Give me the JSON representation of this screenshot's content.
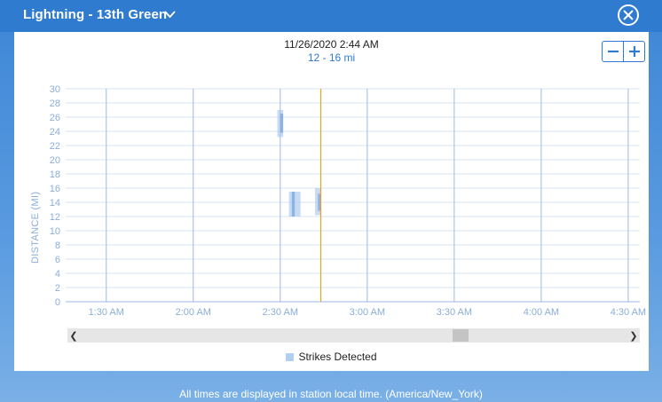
{
  "window": {
    "title": "Lightning - 13th Green"
  },
  "header": {
    "timestamp": "11/26/2020 2:44 AM",
    "range": "12 - 16 mi"
  },
  "colors": {
    "accent": "#2f7bd0",
    "strike_fill": "#a9c8ef",
    "strike_core": "#7aa6de",
    "current_time_line": "#f0a020",
    "grid": "#dbe6f2",
    "time_grid": "#9bbbe3"
  },
  "chart_data": {
    "type": "scatter",
    "ylabel": "DISTANCE (MI)",
    "ylim": [
      0,
      30
    ],
    "yticks": [
      0,
      2,
      4,
      6,
      8,
      10,
      12,
      14,
      16,
      18,
      20,
      22,
      24,
      26,
      28,
      30
    ],
    "x_tick_labels": [
      "1:30 AM",
      "2:00 AM",
      "2:30 AM",
      "3:00 AM",
      "3:30 AM",
      "4:00 AM",
      "4:30 AM"
    ],
    "x_tick_minutes": [
      90,
      120,
      150,
      180,
      210,
      240,
      270
    ],
    "xlim_minutes": [
      76,
      274
    ],
    "current_time_minutes": 164,
    "series": [
      {
        "name": "Strikes Detected",
        "strikes": [
          {
            "t0": 149,
            "t1": 151,
            "d0": 23.2,
            "d1": 27.0
          },
          {
            "t0": 150,
            "t1": 151,
            "d0": 23.8,
            "d1": 26.5
          },
          {
            "t0": 153,
            "t1": 157,
            "d0": 12.0,
            "d1": 15.5
          },
          {
            "t0": 154,
            "t1": 155,
            "d0": 12.0,
            "d1": 15.5
          },
          {
            "t0": 162,
            "t1": 164,
            "d0": 12.2,
            "d1": 16.0
          },
          {
            "t0": 163,
            "t1": 164,
            "d0": 12.8,
            "d1": 15.2
          }
        ]
      }
    ]
  },
  "legend": {
    "label": "Strikes Detected"
  },
  "footer": {
    "note": "All times are displayed in station local time. (America/New_York)"
  }
}
